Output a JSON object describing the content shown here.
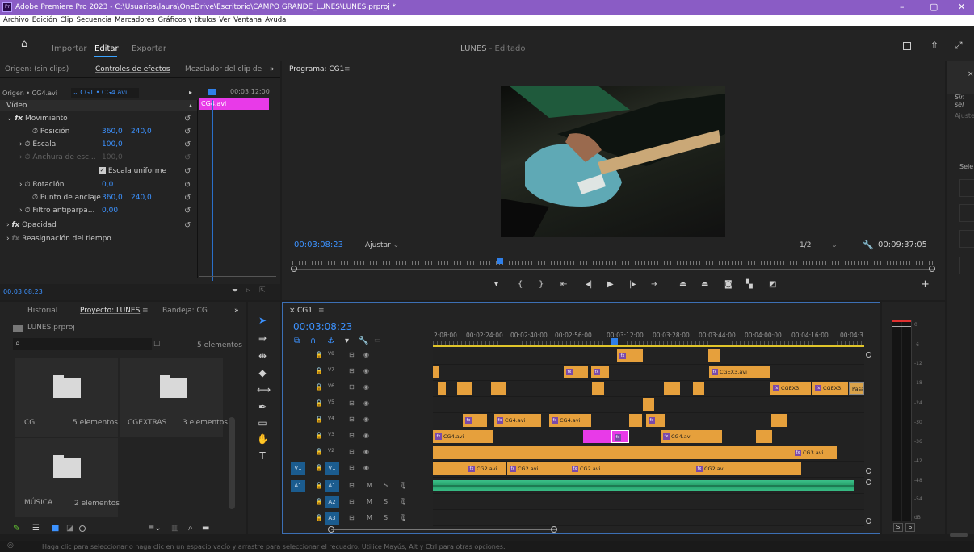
{
  "title_bar": {
    "app_icon": "Pr",
    "title": "Adobe Premiere Pro 2023 - C:\\Usuarios\\laura\\OneDrive\\Escritorio\\CAMPO GRANDE_LUNES\\LUNES.prproj *",
    "minimize": "–",
    "maximize": "▢",
    "close": "✕"
  },
  "menu": [
    "Archivo",
    "Edición",
    "Clip",
    "Secuencia",
    "Marcadores",
    "Gráficos y títulos",
    "Ver",
    "Ventana",
    "Ayuda"
  ],
  "header": {
    "home_icon": "home-icon",
    "workspaces": [
      "Importar",
      "Editar",
      "Exportar"
    ],
    "project_name": "LUNES",
    "project_status": "- Editado"
  },
  "source_tabs": {
    "origin": "Origen: (sin clips)",
    "effect_controls": "Controles de efectos",
    "mixer": "Mezclador del clip de",
    "more": "»"
  },
  "effect_controls": {
    "source": "Origen • CG4.avi",
    "sequence": "CG1 • CG4.avi",
    "timecode_right": "00:03:12:00",
    "clip_label": "CG4.avi",
    "section": "Vídeo",
    "rows": [
      {
        "label": "Movimiento",
        "indent": 1,
        "fx": true
      },
      {
        "label": "Posición",
        "indent": 2,
        "v1": "360,0",
        "v2": "240,0"
      },
      {
        "label": "Escala",
        "indent": 2,
        "v1": "100,0"
      },
      {
        "label": "Anchura de esc...",
        "indent": 2,
        "v1": "100,0",
        "dim": true
      },
      {
        "label": "Escala uniforme",
        "indent": 3,
        "checkbox": true
      },
      {
        "label": "Rotación",
        "indent": 2,
        "v1": "0,0"
      },
      {
        "label": "Punto de anclaje",
        "indent": 2,
        "v1": "360,0",
        "v2": "240,0"
      },
      {
        "label": "Filtro antiparpa...",
        "indent": 2,
        "v1": "0,00"
      },
      {
        "label": "Opacidad",
        "indent": 1,
        "fx": true
      },
      {
        "label": "Reasignación del tiempo",
        "indent": 1,
        "fx": true,
        "dim": true
      }
    ],
    "bottom_time": "00:03:08:23"
  },
  "program": {
    "tab": "Programa: CG1",
    "current_time": "00:03:08:23",
    "fit": "Ajustar",
    "resolution": "1/2",
    "duration": "00:09:37:05"
  },
  "project_panel": {
    "tabs": [
      "Historial",
      "Proyecto: LUNES",
      "Bandeja: CG",
      "»"
    ],
    "file": "LUNES.prproj",
    "count": "5 elementos",
    "bins": [
      {
        "name": "CG",
        "count": "5 elementos"
      },
      {
        "name": "CGEXTRAS",
        "count": "3 elementos"
      },
      {
        "name": "MÚSICA",
        "count": "2 elementos"
      }
    ]
  },
  "timeline": {
    "tab": "CG1",
    "timecode": "00:03:08:23",
    "ticks": [
      "2:08:00",
      "00:02:24:00",
      "00:02:40:00",
      "00:02:56:00",
      "00:03:12:00",
      "00:03:28:00",
      "00:03:44:00",
      "00:04:00:00",
      "00:04:16:00",
      "00:04:3"
    ],
    "video_tracks": [
      "V8",
      "V7",
      "V6",
      "V5",
      "V4",
      "V3",
      "V2",
      "V1"
    ],
    "audio_tracks": [
      "A1",
      "A2",
      "A3"
    ],
    "clip_labels": {
      "cgex3": "CGEX3.avi",
      "cgex3_short": "CGEX3.",
      "pasa": "Pasa",
      "cg4": "CG4.avi",
      "cg3": "CG3.avi",
      "cg2": "CG2.avi"
    }
  },
  "meter": {
    "scale": [
      "0",
      "-6",
      "-12",
      "-18",
      "-24",
      "-30",
      "-36",
      "-42",
      "-48",
      "-54",
      "dB"
    ],
    "solo": [
      "S",
      "S"
    ]
  },
  "status": "Haga clic para seleccionar o haga clic en un espacio vacío y arrastre para seleccionar el recuadro. Utilice Mayús, Alt y Ctrl para otras opciones.",
  "right_panel": {
    "label1": "Sin sel",
    "label2": "Ajuste",
    "label3": "Sele"
  }
}
